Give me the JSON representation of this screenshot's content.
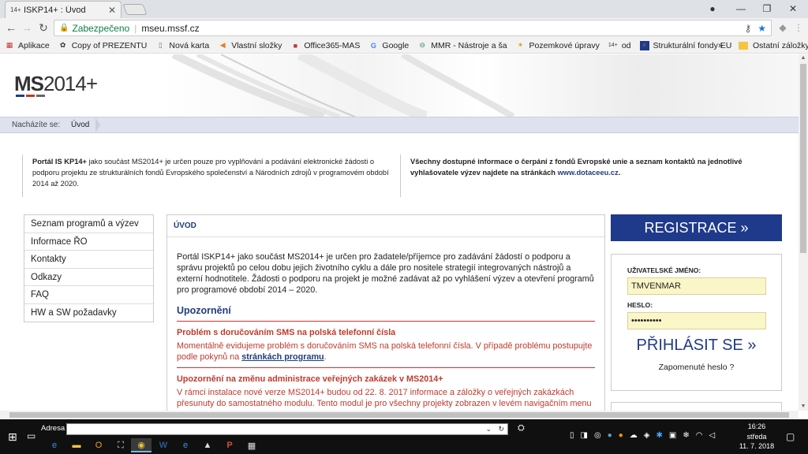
{
  "browser": {
    "tab_title": "ISKP14+ : Úvod",
    "tab_favicon": "14+",
    "secure_label": "Zabezpečeno",
    "url": "mseu.mssf.cz",
    "bookmarks": [
      {
        "label": "Aplikace",
        "icon": "apps-grid-icon"
      },
      {
        "label": "Copy of PREZENTU",
        "icon": "mas-logo-icon"
      },
      {
        "label": "Nová karta",
        "icon": "page-icon"
      },
      {
        "label": "Vlastní složky",
        "icon": "arrow-icon"
      },
      {
        "label": "Office365-MAS",
        "icon": "office-logo-icon"
      },
      {
        "label": "Google",
        "icon": "google-icon"
      },
      {
        "label": "MMR - Nástroje a ša",
        "icon": "mmr-icon"
      },
      {
        "label": "Pozemkové úpravy",
        "icon": "leaf-icon"
      },
      {
        "label": "od",
        "icon": "14plus-icon"
      },
      {
        "label": "Strukturální fondy EU",
        "icon": "eu-flag-icon"
      }
    ],
    "bookmarks_more": "»",
    "other_bookmarks": "Ostatní záložky"
  },
  "page": {
    "logo_bold": "MS",
    "logo_rest": "2014+",
    "logo_colors": [
      "#1f3a8a",
      "#c0392b",
      "#666666"
    ],
    "breadcrumb_label": "Nacházíte se:",
    "breadcrumb_current": "Úvod",
    "intro_left_bold": "Portál IS KP14+",
    "intro_left_text": " jako součást MS2014+ je určen pouze pro vyplňování a podávání elektronické žádosti o podporu projektu ze strukturálních fondů Evropského společenství a Národních zdrojů v programovém období 2014 až 2020.",
    "intro_right_text": "Všechny dostupné informace o čerpání z fondů Evropské unie a seznam kontaktů na jednotlivé vyhlašovatele výzev najdete na stránkách ",
    "intro_right_link": "www.dotaceeu.cz",
    "intro_right_end": ".",
    "menu": [
      "Seznam programů a výzev",
      "Informace ŘO",
      "Kontakty",
      "Odkazy",
      "FAQ",
      "HW a SW požadavky"
    ],
    "main_title": "ÚVOD",
    "main_lead": "Portál ISKP14+ jako součást MS2014+ je určen pro žadatele/příjemce pro zadávání žádostí o podporu a správu projektů po celou dobu jejich životního cyklu a dále pro nositele strategií integrovaných nástrojů a externí hodnotitele. Žádosti o podporu na projekt je možné zadávat až po vyhlášení výzev a otevření programů pro programové období 2014 – 2020.",
    "warnings_heading": "Upozornění",
    "notice1_title": "Problém s doručováním SMS na polská telefonní čísla",
    "notice1_text": "Momentálně evidujeme problém s doručováním SMS na polská telefonní čísla. V případě problému postupujte podle pokynů na ",
    "notice1_link": "stránkách programu",
    "notice1_end": ".",
    "notice2_title": "Upozornění na změnu administrace veřejných zakázek v MS2014+",
    "notice2_text": "V rámci instalace nové verze MS2014+ budou od 22. 8. 2017 informace a záložky o veřejných zakázkách přesunuty do samostatného modulu. Tento modul je pro všechny projekty zobrazen v levém navigačním menu v části \"Informování o realizaci\".",
    "register_label": "REGISTRACE »",
    "username_label": "UŽIVATELSKÉ JMÉNO:",
    "username_value": "TMVENMAR",
    "password_label": "HESLO:",
    "password_value": "••••••••••",
    "login_label": "PŘIHLÁSIT SE »",
    "forgot_label": "Zapomenuté heslo ?"
  },
  "taskbar": {
    "address_label": "Adresa",
    "time": "16:26",
    "day": "středa",
    "date": "11. 7. 2018"
  }
}
